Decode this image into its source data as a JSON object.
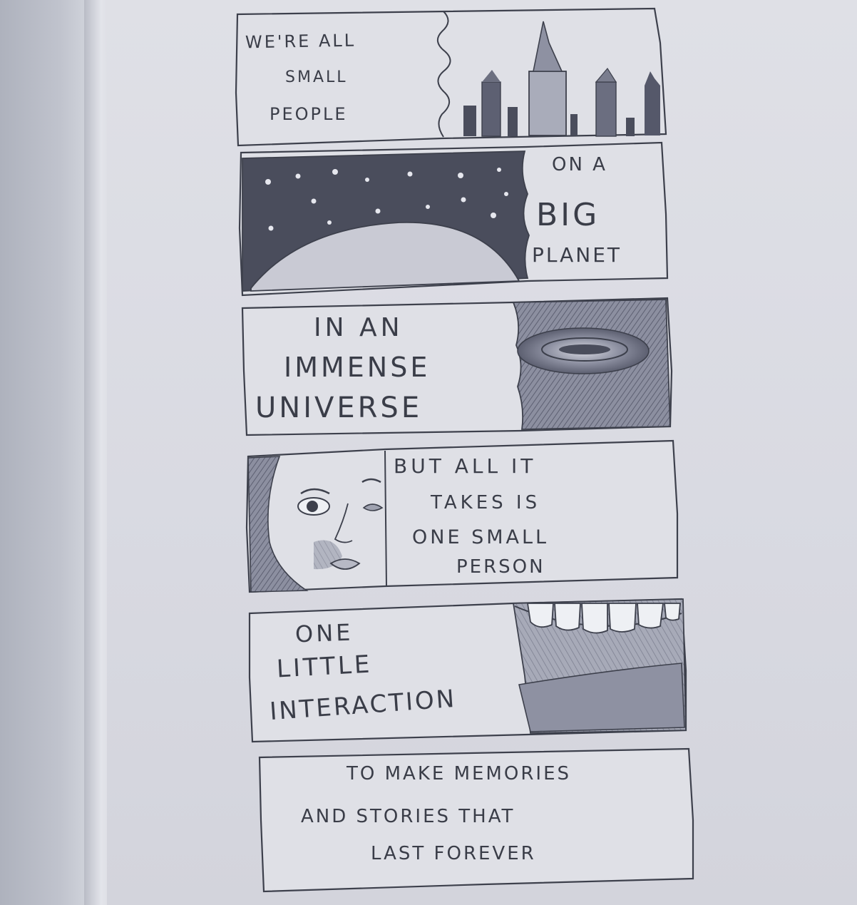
{
  "comic": {
    "panels": [
      {
        "id": 1,
        "lines": [
          "WE'RE ALL",
          "SMALL",
          "PEOPLE"
        ],
        "picture": "city skyline"
      },
      {
        "id": 2,
        "lines": [
          "ON A",
          "BIG",
          "PLANET"
        ],
        "picture": "planet under starry sky"
      },
      {
        "id": 3,
        "lines": [
          "IN AN",
          "IMMENSE",
          "UNIVERSE"
        ],
        "picture": "galaxy in dark space"
      },
      {
        "id": 4,
        "lines": [
          "BUT ALL IT",
          "TAKES IS",
          "ONE SMALL",
          "PERSON"
        ],
        "picture": "woman's face"
      },
      {
        "id": 5,
        "lines": [
          "ONE",
          "LITTLE",
          "INTERACTION"
        ],
        "picture": "smiling mouth"
      },
      {
        "id": 6,
        "lines": [
          "TO MAKE MEMORIES",
          "AND STORIES THAT",
          "LAST FOREVER"
        ],
        "picture": ""
      }
    ]
  },
  "colors": {
    "ink": "#3a3d48",
    "paper": "#dcdde4",
    "shade": "#4a4d5c"
  }
}
